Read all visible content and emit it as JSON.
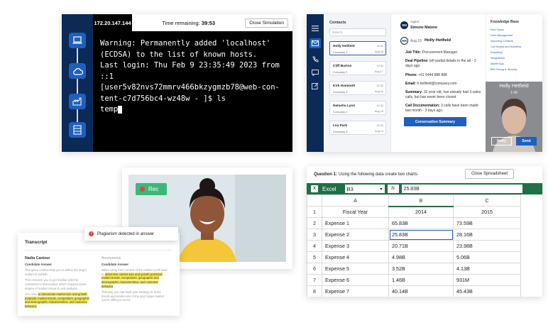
{
  "terminal": {
    "ip": "172.20.147.144",
    "timer_label": "Time remaining:",
    "timer_value": "39:53",
    "close_label": "Close Simulation",
    "text": "Warning: Permanently added 'localhost' (ECDSA) to the list of known hosts.\nLast login: Thu Feb 9 23:35:49 2023 from ::1\n[user5v82nvs72mmrv466bkzygmzb78@web-con-tent-c7d756bc4-wz48w - ]$ ls\ntemp",
    "side_icons": [
      "laptop-icon",
      "cloud-icon",
      "factory-icon",
      "server-icon"
    ]
  },
  "agent": {
    "contacts_title": "Contacts",
    "search_placeholder": "Search",
    "contacts": [
      {
        "name": "Holly Hetfield",
        "company": "Company 1",
        "time": "10:32",
        "date": "Aug 18"
      },
      {
        "name": "Cliff Burton",
        "company": "Company 2",
        "time": "10:32",
        "date": "Aug 17"
      },
      {
        "name": "Kirk Hammett",
        "company": "Company 3",
        "time": "10:32",
        "date": "Aug 16"
      },
      {
        "name": "Natasha Lyon",
        "company": "Company 4",
        "time": "10:32",
        "date": "Aug 15"
      },
      {
        "name": "Lea Park",
        "company": "Company 5",
        "time": "10:32",
        "date": "Aug 14"
      }
    ],
    "agent_initials": "SM",
    "agent_role": "Agent",
    "agent_name": "Simone Malone",
    "contact_initials": "HH",
    "contact_date": "Aug 18",
    "contact_name": "Holly Hetfield",
    "fields": [
      {
        "label": "Job Title:",
        "value": "Procurement Manager"
      },
      {
        "label": "Deal Pipeline:",
        "value": "left partial details in the ad - 3 days ago"
      },
      {
        "label": "Phone:",
        "value": "+61 5444 888 888"
      },
      {
        "label": "Email:",
        "value": "h.hetfield@company.com"
      },
      {
        "label": "Summary:",
        "value": "32 year old, has already had 3 sales calls, but has never been closed"
      },
      {
        "label": "Call Documentation:",
        "value": "3 calls have been made last month - 3 days ago"
      }
    ],
    "conversation_button": "Conversation Summary",
    "kb_title": "Knowledge Base",
    "kb_items": [
      "Plan Types",
      "User Management",
      "Importing Contacts",
      "Call Scripts and Workflow",
      "Reporting",
      "Integrations",
      "Mobile App",
      "BRI Pricing & Security"
    ],
    "video_name": "Holly Hetfield",
    "video_time": "1:48",
    "retry_label": "Retry",
    "send_label": "Send"
  },
  "interview": {
    "rec_label": "Rec"
  },
  "transcript": {
    "title": "Transcript",
    "left_name": "Nadia Cantour",
    "left_sub": "Candidate Answer",
    "left_paras": [
      {
        "text": "This given context help you to define the target market to publish."
      },
      {
        "text": "This research you to get familiar with the customers in that market, which requires some degree of market research and analysis."
      },
      {
        "pre": "You need ",
        "hl": "to demarcate market size and growth potential, market trends, competitors, geographic and demographic characteristics, and customer behavior.",
        "post": ""
      }
    ],
    "right_name": "Anonymous",
    "right_sub": "Candidate Answer",
    "right_paras": [
      {
        "pre": "When using from context of the market you'll want to ",
        "hl": "determine market size and growth potential, market trends, competitors, geographic and demographic characteristics, and customer behavior",
        "post": "."
      },
      {
        "text": "This way you can build your strategy to fit the trends and tendencies of the your target market you're willing to sense."
      }
    ]
  },
  "plagiarism": {
    "text": "Plagiarism detected in answer"
  },
  "sheet": {
    "question_prefix": "Question 1:",
    "question_text": "Using the following data create two charts",
    "close_label": "Close Spreadsheet",
    "excel_label": "Excel",
    "namebox": "B3",
    "fx": "fx",
    "formula": "25.83B",
    "columns": [
      "A",
      "B",
      "C"
    ],
    "rows": [
      {
        "n": "1",
        "a": "Fiscal Year",
        "b": "2014",
        "c": "2015"
      },
      {
        "n": "2",
        "a": "Expense 1",
        "b": "65.83B",
        "c": "73.59B"
      },
      {
        "n": "3",
        "a": "Expense 2",
        "b": "25.83B",
        "c": "28.16B"
      },
      {
        "n": "4",
        "a": "Expense 3",
        "b": "20.71B",
        "c": "23.98B"
      },
      {
        "n": "5",
        "a": "Expense 4",
        "b": "4.98B",
        "c": "5.06B"
      },
      {
        "n": "6",
        "a": "Expense 5",
        "b": "3.52B",
        "c": "4.13B"
      },
      {
        "n": "7",
        "a": "Expense 6",
        "b": "1.46B",
        "c": "931M"
      },
      {
        "n": "8",
        "a": "Expense 7",
        "b": "40.14B",
        "c": "45.43B"
      }
    ]
  }
}
